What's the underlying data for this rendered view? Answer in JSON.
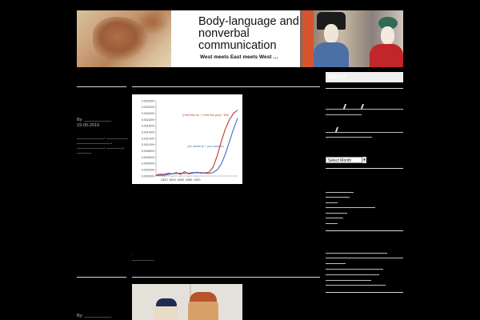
{
  "header": {
    "title": "Body-language and nonverbal communication",
    "tagline": "West meets East meets West …"
  },
  "post1": {
    "by": "By: ___________",
    "date": "19-05-2016",
    "tags_line1": "___________, _________",
    "tags_line2": "______________,",
    "tags_line3": "___________, _______,",
    "tags_line4": "______",
    "after_chart_dot": ".",
    "after_chart_link": "_________"
  },
  "post2": {
    "by": "By: ___________"
  },
  "sidebar": {
    "search_label": "Search",
    "archive_select": "Select Month",
    "archive_arrow": "▼"
  },
  "chart_data": {
    "type": "line",
    "title": "",
    "x": [
      1800,
      1810,
      1820,
      1830,
      1840,
      1850,
      1860,
      1870,
      1880,
      1890,
      1900,
      1910,
      1920,
      1930,
      1940,
      1950,
      1960,
      1970,
      1980,
      1990,
      2000
    ],
    "xticks": [
      "1820",
      "1840",
      "1860",
      "1880",
      "1900"
    ],
    "yticks": [
      "0.00000%",
      "0.00020%",
      "0.00040%",
      "0.00060%",
      "0.00080%",
      "0.00100%",
      "0.00120%",
      "0.00140%",
      "0.00160%",
      "0.00180%",
      "0.00200%",
      "0.00220%",
      "0.00240%"
    ],
    "ylim": [
      0,
      0.0024
    ],
    "series": [
      {
        "name": "(I feel like he + I feel like you) * 500",
        "color": "#c0392b",
        "values": [
          3e-05,
          6e-05,
          5e-05,
          9e-05,
          7e-05,
          0.00011,
          5e-05,
          0.00014,
          7e-05,
          9e-05,
          0.00012,
          9e-05,
          0.0001,
          0.00012,
          0.00028,
          0.00065,
          0.0011,
          0.0015,
          0.0018,
          0.002,
          0.0021
        ]
      },
      {
        "name": "(he needs to + you need to)",
        "color": "#3a6fc4",
        "values": [
          2e-05,
          2e-05,
          3e-05,
          5e-05,
          7e-05,
          8e-05,
          9e-05,
          8e-05,
          9e-05,
          0.00011,
          0.0001,
          0.00011,
          9e-05,
          8e-05,
          0.00011,
          0.0002,
          0.00038,
          0.0007,
          0.0011,
          0.0015,
          0.00185
        ]
      }
    ]
  }
}
